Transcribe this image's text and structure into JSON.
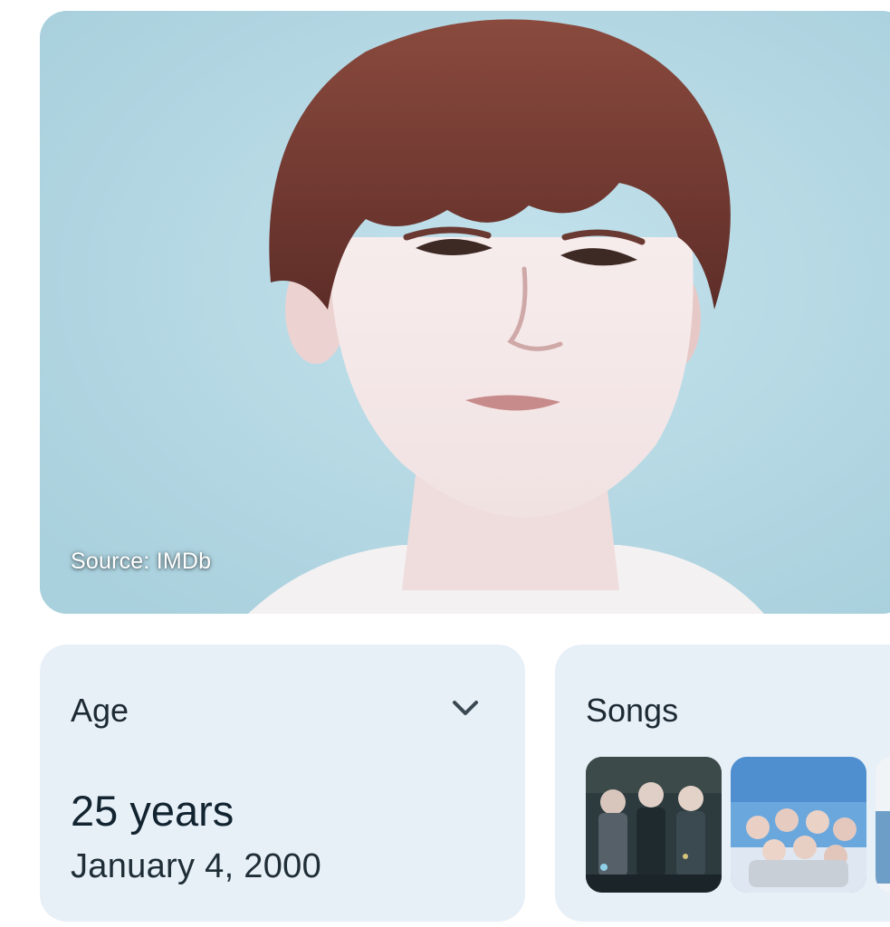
{
  "hero": {
    "source_caption": "Source: IMDb",
    "image_subject": "portrait photo"
  },
  "age_card": {
    "title": "Age",
    "value": "25 years",
    "birth_date": "January 4, 2000",
    "expand_icon": "chevron-down-icon"
  },
  "songs_card": {
    "title": "Songs",
    "thumbnails": [
      {
        "icon": "song-thumbnail-image"
      },
      {
        "icon": "song-thumbnail-image"
      },
      {
        "icon": "song-thumbnail-image"
      }
    ]
  },
  "colors": {
    "card_background": "#e7eff7",
    "photo_background": "#b7d9e5",
    "text_primary": "#122430"
  }
}
